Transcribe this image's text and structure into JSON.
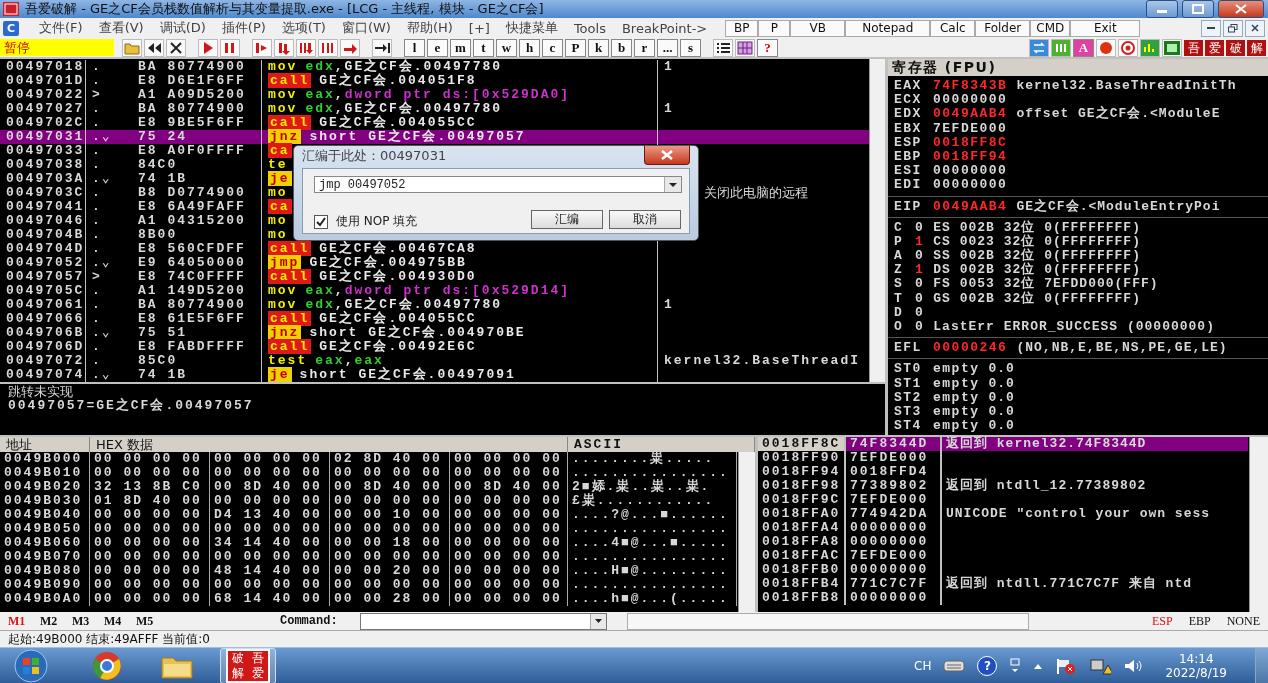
{
  "window": {
    "title": "吾爱破解 - GE之CF会员栈数值解析与其变量提取.exe - [LCG - 主线程, 模块 - GE之CF会]"
  },
  "menubar": {
    "logo": "C",
    "menus": [
      "文件(F)",
      "查看(V)",
      "调试(D)",
      "插件(P)",
      "选项(T)",
      "窗口(W)",
      "帮助(H)",
      "[+]",
      "快捷菜单",
      "Tools",
      "BreakPoint->"
    ],
    "quick_buttons": [
      "BP",
      "P",
      "VB",
      "Notepad",
      "Calc",
      "Folder",
      "CMD",
      "Exit"
    ]
  },
  "toolbar": {
    "status": "暂停",
    "letters": [
      "l",
      "e",
      "m",
      "t",
      "w",
      "h",
      "c",
      "P",
      "k",
      "b",
      "r",
      "...",
      "s"
    ],
    "help": "?",
    "badge": "A",
    "tiles": [
      "吾",
      "爱",
      "破",
      "解"
    ]
  },
  "disassembly": {
    "rows": [
      {
        "address": "00497018",
        "mark": ".",
        "hex": "BA 80774900",
        "instr": [
          {
            "text": "mov",
            "kind": "op"
          },
          {
            "text": "edx",
            "kind": "reg"
          },
          {
            "text": ",GE之CF会.00497780",
            "kind": "plain"
          }
        ],
        "comment": "1",
        "selected": false
      },
      {
        "address": "0049701D",
        "mark": ".",
        "hex": "E8 D6E1F6FF",
        "instr": [
          {
            "text": "call",
            "kind": "call"
          },
          {
            "text": "GE之CF会.004051F8",
            "kind": "plain"
          }
        ],
        "selected": false
      },
      {
        "address": "00497022",
        "mark": ">",
        "hex": "A1 A09D5200",
        "instr": [
          {
            "text": "mov",
            "kind": "op"
          },
          {
            "text": "eax",
            "kind": "reg"
          },
          {
            "text": ",",
            "kind": "plain"
          },
          {
            "text": "dword ptr ds:[0x529DA0]",
            "kind": "mem"
          }
        ],
        "selected": false
      },
      {
        "address": "00497027",
        "mark": ".",
        "hex": "BA 80774900",
        "instr": [
          {
            "text": "mov",
            "kind": "op"
          },
          {
            "text": "edx",
            "kind": "reg"
          },
          {
            "text": ",GE之CF会.00497780",
            "kind": "plain"
          }
        ],
        "comment": "1",
        "selected": false
      },
      {
        "address": "0049702C",
        "mark": ".",
        "hex": "E8 9BE5F6FF",
        "instr": [
          {
            "text": "call",
            "kind": "call"
          },
          {
            "text": "GE之CF会.004055CC",
            "kind": "plain"
          }
        ],
        "selected": false
      },
      {
        "address": "00497031",
        "mark": ".⌄",
        "hex": "75 24",
        "instr": [
          {
            "text": "jnz",
            "kind": "jump"
          },
          {
            "text": "short GE之CF会.00497057",
            "kind": "plain"
          }
        ],
        "selected": true
      },
      {
        "address": "00497033",
        "mark": ".",
        "hex": "E8 A0F0FFFF",
        "instr": [
          {
            "text": "ca",
            "kind": "call"
          }
        ],
        "selected": false
      },
      {
        "address": "00497038",
        "mark": ".",
        "hex": "84C0",
        "instr": [
          {
            "text": "te",
            "kind": "op"
          }
        ],
        "selected": false
      },
      {
        "address": "0049703A",
        "mark": ".⌄",
        "hex": "74 1B",
        "instr": [
          {
            "text": "je",
            "kind": "jump"
          }
        ],
        "selected": false
      },
      {
        "address": "0049703C",
        "mark": ".",
        "hex": "B8 D0774900",
        "instr": [
          {
            "text": "mo",
            "kind": "op"
          }
        ],
        "comment": "关闭此电脑的远程",
        "selected": false
      },
      {
        "address": "00497041",
        "mark": ".",
        "hex": "E8 6A49FAFF",
        "instr": [
          {
            "text": "ca",
            "kind": "call"
          }
        ],
        "selected": false
      },
      {
        "address": "00497046",
        "mark": ".",
        "hex": "A1 04315200",
        "instr": [
          {
            "text": "mo",
            "kind": "op"
          }
        ],
        "selected": false
      },
      {
        "address": "0049704B",
        "mark": ".",
        "hex": "8B00",
        "instr": [
          {
            "text": "mo",
            "kind": "op"
          }
        ],
        "selected": false
      },
      {
        "address": "0049704D",
        "mark": ".",
        "hex": "E8 560CFDFF",
        "instr": [
          {
            "text": "call",
            "kind": "call"
          },
          {
            "text": "GE之CF会.00467CA8",
            "kind": "plain"
          }
        ],
        "selected": false
      },
      {
        "address": "00497052",
        "mark": ".⌄",
        "hex": "E9 64050000",
        "instr": [
          {
            "text": "jmp",
            "kind": "jump"
          },
          {
            "text": "GE之CF会.004975BB",
            "kind": "plain"
          }
        ],
        "selected": false
      },
      {
        "address": "00497057",
        "mark": ">",
        "hex": "E8 74C0FFFF",
        "instr": [
          {
            "text": "call",
            "kind": "call"
          },
          {
            "text": "GE之CF会.004930D0",
            "kind": "plain"
          }
        ],
        "selected": false
      },
      {
        "address": "0049705C",
        "mark": ".",
        "hex": "A1 149D5200",
        "instr": [
          {
            "text": "mov",
            "kind": "op"
          },
          {
            "text": "eax",
            "kind": "reg"
          },
          {
            "text": ",",
            "kind": "plain"
          },
          {
            "text": "dword ptr ds:[0x529D14]",
            "kind": "mem"
          }
        ],
        "selected": false
      },
      {
        "address": "00497061",
        "mark": ".",
        "hex": "BA 80774900",
        "instr": [
          {
            "text": "mov",
            "kind": "op"
          },
          {
            "text": "edx",
            "kind": "reg"
          },
          {
            "text": ",GE之CF会.00497780",
            "kind": "plain"
          }
        ],
        "comment": "1",
        "selected": false
      },
      {
        "address": "00497066",
        "mark": ".",
        "hex": "E8 61E5F6FF",
        "instr": [
          {
            "text": "call",
            "kind": "call"
          },
          {
            "text": "GE之CF会.004055CC",
            "kind": "plain"
          }
        ],
        "selected": false
      },
      {
        "address": "0049706B",
        "mark": ".⌄",
        "hex": "75 51",
        "instr": [
          {
            "text": "jnz",
            "kind": "jump"
          },
          {
            "text": "short GE之CF会.004970BE",
            "kind": "plain"
          }
        ],
        "selected": false
      },
      {
        "address": "0049706D",
        "mark": ".",
        "hex": "E8 FABDFFFF",
        "instr": [
          {
            "text": "call",
            "kind": "call"
          },
          {
            "text": "GE之CF会.00492E6C",
            "kind": "plain"
          }
        ],
        "selected": false
      },
      {
        "address": "00497072",
        "mark": ".",
        "hex": "85C0",
        "instr": [
          {
            "text": "test",
            "kind": "op"
          },
          {
            "text": "eax",
            "kind": "reg"
          },
          {
            "text": ",",
            "kind": "plain"
          },
          {
            "text": "eax",
            "kind": "reg"
          }
        ],
        "comment": "kernel32.BaseThreadI",
        "selected": false
      },
      {
        "address": "00497074",
        "mark": ".⌄",
        "hex": "74 1B",
        "instr": [
          {
            "text": "je",
            "kind": "jump"
          },
          {
            "text": "short GE之CF会.00497091",
            "kind": "plain"
          }
        ],
        "selected": false
      }
    ],
    "info": [
      "跳转未实现",
      "00497057=GE之CF会.00497057"
    ]
  },
  "dialog": {
    "title": "汇编于此处：00497031",
    "input": "jmp 00497052",
    "nop_fill": {
      "label": "使用 NOP 填充",
      "checked": true
    },
    "buttons": [
      "汇编",
      "取消"
    ]
  },
  "registers": {
    "title": "寄存器 (FPU)",
    "groups": [
      [
        {
          "name": "EAX",
          "value": "74F8343B",
          "changed": true,
          "comment": "kernel32.BaseThreadInitTh"
        },
        {
          "name": "ECX",
          "value": "00000000",
          "changed": false
        },
        {
          "name": "EDX",
          "value": "0049AAB4",
          "changed": true,
          "comment": "offset GE之CF会.<ModuleE"
        },
        {
          "name": "EBX",
          "value": "7EFDE000",
          "changed": false
        },
        {
          "name": "ESP",
          "value": "0018FF8C",
          "changed": true
        },
        {
          "name": "EBP",
          "value": "0018FF94",
          "changed": true
        },
        {
          "name": "ESI",
          "value": "00000000",
          "changed": false
        },
        {
          "name": "EDI",
          "value": "00000000",
          "changed": false
        }
      ],
      [
        {
          "name": "EIP",
          "value": "0049AAB4",
          "changed": true,
          "comment": "GE之CF会.<ModuleEntryPoi"
        }
      ],
      [
        {
          "name": "C",
          "value": "0",
          "changed": false,
          "comment": "ES 002B 32位 0(FFFFFFFF)"
        },
        {
          "name": "P",
          "value": "1",
          "changed": true,
          "comment": "CS 0023 32位 0(FFFFFFFF)"
        },
        {
          "name": "A",
          "value": "0",
          "changed": false,
          "comment": "SS 002B 32位 0(FFFFFFFF)"
        },
        {
          "name": "Z",
          "value": "1",
          "changed": true,
          "comment": "DS 002B 32位 0(FFFFFFFF)"
        },
        {
          "name": "S",
          "value": "0",
          "changed": false,
          "comment": "FS 0053 32位 7EFDD000(FFF)"
        },
        {
          "name": "T",
          "value": "0",
          "changed": false,
          "comment": "GS 002B 32位 0(FFFFFFFF)"
        },
        {
          "name": "D",
          "value": "0",
          "changed": false
        },
        {
          "name": "O",
          "value": "0",
          "changed": false,
          "comment": "LastErr ERROR_SUCCESS (00000000)"
        }
      ],
      [
        {
          "name": "EFL",
          "value": "00000246",
          "changed": true,
          "comment": "(NO,NB,E,BE,NS,PE,GE,LE)"
        }
      ],
      [
        {
          "name": "ST0",
          "value": "empty",
          "changed": false,
          "comment": "0.0"
        },
        {
          "name": "ST1",
          "value": "empty",
          "changed": false,
          "comment": "0.0"
        },
        {
          "name": "ST2",
          "value": "empty",
          "changed": false,
          "comment": "0.0"
        },
        {
          "name": "ST3",
          "value": "empty",
          "changed": false,
          "comment": "0.0"
        },
        {
          "name": "ST4",
          "value": "empty",
          "changed": false,
          "comment": "0.0"
        }
      ]
    ]
  },
  "dump": {
    "columns": [
      "地址",
      "HEX 数据",
      "ASCII"
    ],
    "rows": [
      {
        "address": "0049B000",
        "hex": [
          "00 00 00 00",
          "00 00 00 00",
          "02 8D 40 00",
          "00 00 00 00"
        ],
        "ascii": "........粜....."
      },
      {
        "address": "0049B010",
        "hex": [
          "00 00 00 00",
          "00 00 00 00",
          "00 00 00 00",
          "00 00 00 00"
        ],
        "ascii": "................"
      },
      {
        "address": "0049B020",
        "hex": [
          "32 13 8B C0",
          "00 8D 40 00",
          "00 8D 40 00",
          "00 8D 40 00"
        ],
        "ascii": "2■婖.粜..粜..粜."
      },
      {
        "address": "0049B030",
        "hex": [
          "01 8D 40 00",
          "00 00 00 00",
          "00 00 00 00",
          "00 00 00 00"
        ],
        "ascii": "£粜............"
      },
      {
        "address": "0049B040",
        "hex": [
          "00 00 00 00",
          "D4 13 40 00",
          "00 00 10 00",
          "00 00 00 00"
        ],
        "ascii": "....?@...■......"
      },
      {
        "address": "0049B050",
        "hex": [
          "00 00 00 00",
          "00 00 00 00",
          "00 00 00 00",
          "00 00 00 00"
        ],
        "ascii": "................"
      },
      {
        "address": "0049B060",
        "hex": [
          "00 00 00 00",
          "34 14 40 00",
          "00 00 18 00",
          "00 00 00 00"
        ],
        "ascii": "....4■@...■....."
      },
      {
        "address": "0049B070",
        "hex": [
          "00 00 00 00",
          "00 00 00 00",
          "00 00 00 00",
          "00 00 00 00"
        ],
        "ascii": "................"
      },
      {
        "address": "0049B080",
        "hex": [
          "00 00 00 00",
          "48 14 40 00",
          "00 00 20 00",
          "00 00 00 00"
        ],
        "ascii": "....H■@........."
      },
      {
        "address": "0049B090",
        "hex": [
          "00 00 00 00",
          "00 00 00 00",
          "00 00 00 00",
          "00 00 00 00"
        ],
        "ascii": "................"
      },
      {
        "address": "0049B0A0",
        "hex": [
          "00 00 00 00",
          "68 14 40 00",
          "00 00 28 00",
          "00 00 00 00"
        ],
        "ascii": "....h■@...(....."
      }
    ]
  },
  "stack": {
    "rows": [
      {
        "address": "0018FF8C",
        "value": "74F8344D",
        "comment": "返回到 kernel32.74F8344D",
        "selected": true
      },
      {
        "address": "0018FF90",
        "value": "7EFDE000",
        "selected": false
      },
      {
        "address": "0018FF94",
        "value": "0018FFD4",
        "selected": false
      },
      {
        "address": "0018FF98",
        "value": "77389802",
        "comment": "返回到 ntdll_12.77389802",
        "selected": false
      },
      {
        "address": "0018FF9C",
        "value": "7EFDE000",
        "selected": false
      },
      {
        "address": "0018FFA0",
        "value": "774942DA",
        "comment": "UNICODE \"control your own sess",
        "selected": false
      },
      {
        "address": "0018FFA4",
        "value": "00000000",
        "selected": false
      },
      {
        "address": "0018FFA8",
        "value": "00000000",
        "selected": false
      },
      {
        "address": "0018FFAC",
        "value": "7EFDE000",
        "selected": false
      },
      {
        "address": "0018FFB0",
        "value": "00000000",
        "selected": false
      },
      {
        "address": "0018FFB4",
        "value": "771C7C7F",
        "comment": "返回到 ntdll.771C7C7F 来自 ntd",
        "selected": false
      },
      {
        "address": "0018FFB8",
        "value": "00000000",
        "selected": false
      }
    ]
  },
  "bottom_bar": {
    "marks": [
      {
        "label": "M1",
        "selected": true
      },
      {
        "label": "M2",
        "selected": false
      },
      {
        "label": "M3",
        "selected": false
      },
      {
        "label": "M4",
        "selected": false
      },
      {
        "label": "M5",
        "selected": false
      }
    ],
    "command_label": "Command:",
    "frames": [
      {
        "label": "ESP",
        "selected": true
      },
      {
        "label": "EBP",
        "selected": false
      },
      {
        "label": "NONE",
        "selected": false
      }
    ]
  },
  "status_bar": "起始:49B000 结束:49AFFF 当前值:0",
  "taskbar": {
    "app_tile": [
      "破吾",
      "解爱"
    ],
    "tray": {
      "language": "CH",
      "help": "?",
      "time": "14:14",
      "date": "2022/8/19"
    }
  }
}
